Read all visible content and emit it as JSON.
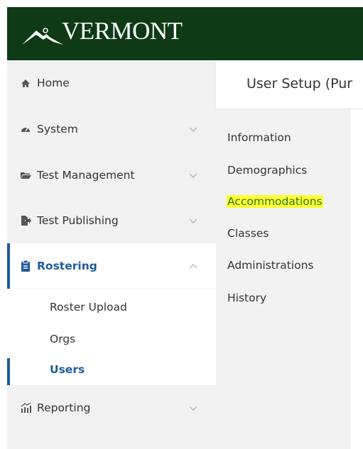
{
  "header": {
    "logo_text": "VERMONT"
  },
  "sidebar": {
    "items": [
      {
        "label": "Home",
        "icon": "home-icon"
      },
      {
        "label": "System",
        "icon": "gauge-icon"
      },
      {
        "label": "Test Management",
        "icon": "folder-icon"
      },
      {
        "label": "Test Publishing",
        "icon": "export-icon"
      },
      {
        "label": "Rostering",
        "icon": "clipboard-icon"
      },
      {
        "label": "Reporting",
        "icon": "bar-chart-icon"
      }
    ],
    "rostering_subitems": [
      {
        "label": "Roster Upload"
      },
      {
        "label": "Orgs"
      },
      {
        "label": "Users"
      }
    ]
  },
  "main": {
    "title": "User Setup (Pur",
    "subnav": [
      {
        "label": "Information"
      },
      {
        "label": "Demographics"
      },
      {
        "label": "Accommodations"
      },
      {
        "label": "Classes"
      },
      {
        "label": "Administrations"
      },
      {
        "label": "History"
      }
    ]
  },
  "colors": {
    "topbar": "#0e3b16",
    "accent": "#1f5c99",
    "sidebar_bg": "#f1f1f1",
    "highlight": "#ffff33"
  }
}
